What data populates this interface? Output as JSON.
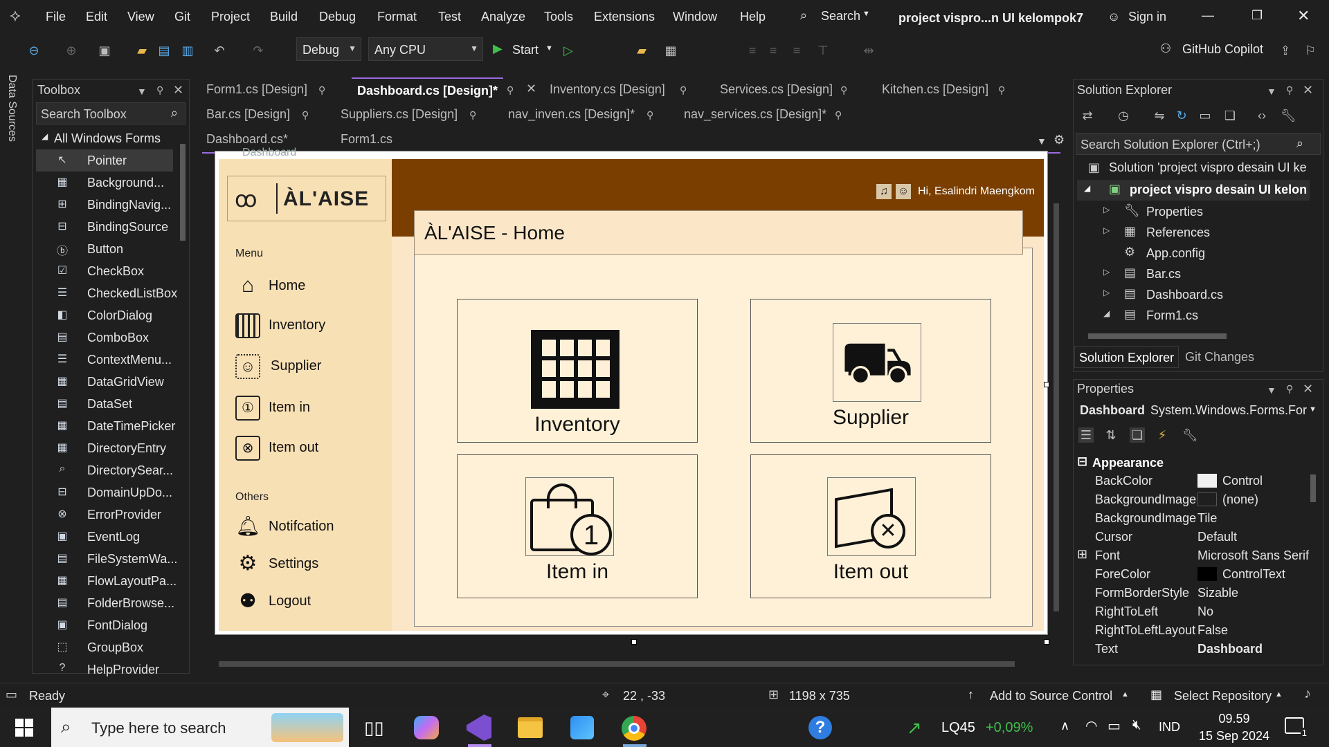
{
  "menubar": {
    "items": [
      "File",
      "Edit",
      "View",
      "Git",
      "Project",
      "Build",
      "Debug",
      "Format",
      "Test",
      "Analyze",
      "Tools",
      "Extensions",
      "Window",
      "Help"
    ],
    "search_label": "Search",
    "window_title": "project vispro...n UI kelompok7",
    "sign_in": "Sign in"
  },
  "toolbar": {
    "config": "Debug",
    "platform": "Any CPU",
    "start_label": "Start",
    "copilot_label": "GitHub Copilot"
  },
  "side_tab": "Data Sources",
  "toolbox": {
    "title": "Toolbox",
    "search_placeholder": "Search Toolbox",
    "group": "All Windows Forms",
    "items": [
      "Pointer",
      "Background...",
      "BindingNavig...",
      "BindingSource",
      "Button",
      "CheckBox",
      "CheckedListBox",
      "ColorDialog",
      "ComboBox",
      "ContextMenu...",
      "DataGridView",
      "DataSet",
      "DateTimePicker",
      "DirectoryEntry",
      "DirectorySear...",
      "DomainUpDo...",
      "ErrorProvider",
      "EventLog",
      "FileSystemWa...",
      "FlowLayoutPa...",
      "FolderBrowse...",
      "FontDialog",
      "GroupBox",
      "HelpProvider"
    ]
  },
  "tabs": {
    "row1": [
      "Form1.cs [Design]",
      "Dashboard.cs [Design]*",
      "Inventory.cs [Design]",
      "Services.cs [Design]",
      "Kitchen.cs [Design]"
    ],
    "row2": [
      "Bar.cs [Design]",
      "Suppliers.cs [Design]",
      "nav_inven.cs [Design]*",
      "nav_services.cs [Design]*"
    ],
    "row3": [
      "Dashboard.cs*",
      "Form1.cs"
    ]
  },
  "form": {
    "window_caption": "Dashboard",
    "logo_text": "ÀL'AISE",
    "greeting": "Hi, Esalindri Maengkom",
    "page_title": "ÀL'AISE - Home",
    "menu_heading": "Menu",
    "menu_items": [
      "Home",
      "Inventory",
      "Supplier",
      "Item in",
      "Item out"
    ],
    "others_heading": "Others",
    "others_items": [
      "Notifcation",
      "Settings",
      "Logout"
    ],
    "cards": [
      "Inventory",
      "Supplier",
      "Item in",
      "Item out"
    ]
  },
  "solution_explorer": {
    "title": "Solution Explorer",
    "search_placeholder": "Search Solution Explorer (Ctrl+;)",
    "solution": "Solution 'project vispro desain UI ke",
    "project": "project vispro desain UI kelon",
    "nodes": [
      "Properties",
      "References",
      "App.config",
      "Bar.cs",
      "Dashboard.cs",
      "Form1.cs"
    ],
    "bottom_tabs": [
      "Solution Explorer",
      "Git Changes"
    ]
  },
  "properties": {
    "title": "Properties",
    "object_name": "Dashboard",
    "object_type": "System.Windows.Forms.For",
    "category": "Appearance",
    "rows": [
      {
        "name": "BackColor",
        "value": "Control"
      },
      {
        "name": "BackgroundImage",
        "value": "(none)"
      },
      {
        "name": "BackgroundImage",
        "value": "Tile"
      },
      {
        "name": "Cursor",
        "value": "Default"
      },
      {
        "name": "Font",
        "value": "Microsoft Sans Serif"
      },
      {
        "name": "ForeColor",
        "value": "ControlText"
      },
      {
        "name": "FormBorderStyle",
        "value": "Sizable"
      },
      {
        "name": "RightToLeft",
        "value": "No"
      },
      {
        "name": "RightToLeftLayout",
        "value": "False"
      },
      {
        "name": "Text",
        "value": "Dashboard"
      }
    ]
  },
  "statusbar": {
    "ready": "Ready",
    "position": "22 , -33",
    "size": "1198 x 735",
    "source_control": "Add to Source Control",
    "repo": "Select Repository"
  },
  "taskbar": {
    "search_placeholder": "Type here to search",
    "stock_name": "LQ45",
    "stock_change": "+0,09%",
    "lang": "IND",
    "time": "09.59",
    "date": "15 Sep 2024",
    "notif_count": "1"
  },
  "colors": {
    "brown_header": "#7a3e00",
    "cream": "#fbe7c8",
    "sidebar": "#f8e0b5",
    "vs_accent": "#9b6cdf"
  }
}
